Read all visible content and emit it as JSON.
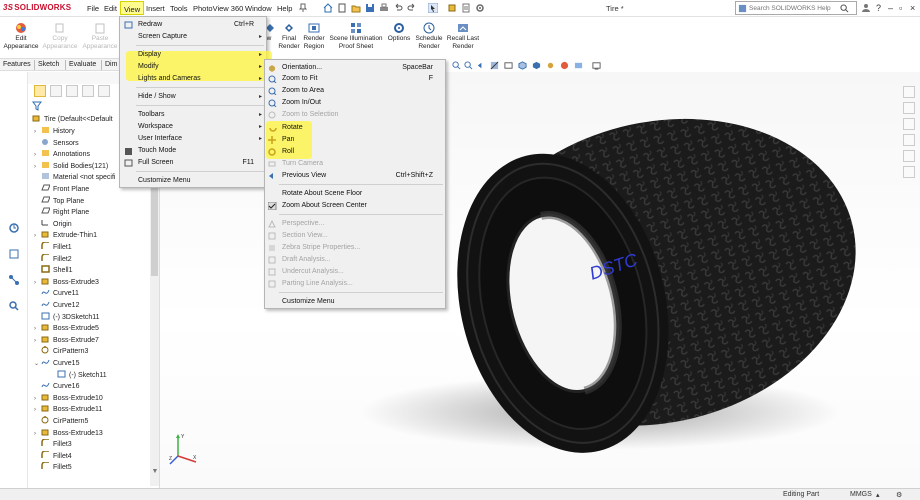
{
  "app": {
    "logo": "SOLIDWORKS",
    "document_title": "Tire *",
    "menus": [
      "File",
      "Edit",
      "View",
      "Insert",
      "Tools",
      "PhotoView 360",
      "Window",
      "Help"
    ],
    "active_menu": "View",
    "help_search_placeholder": "Search SOLIDWORKS Help"
  },
  "ribbon": {
    "buttons": [
      {
        "label": "Edit\nAppearance",
        "enabled": true,
        "icon": "appearance-icon"
      },
      {
        "label": "Copy\nAppearance",
        "enabled": false,
        "icon": "copy-appearance-icon"
      },
      {
        "label": "Paste\nAppearance",
        "enabled": false,
        "icon": "paste-appearance-icon"
      },
      {
        "label": "w",
        "enabled": true,
        "icon": "preview-icon"
      },
      {
        "label": "Final\nRender",
        "enabled": true,
        "icon": "final-render-icon"
      },
      {
        "label": "Render\nRegion",
        "enabled": true,
        "icon": "render-region-icon"
      },
      {
        "label": "Scene Illumination\nProof Sheet",
        "enabled": true,
        "icon": "proof-sheet-icon"
      },
      {
        "label": "Options",
        "enabled": true,
        "icon": "options-icon"
      },
      {
        "label": "Schedule\nRender",
        "enabled": true,
        "icon": "schedule-render-icon"
      },
      {
        "label": "Recall Last\nRender",
        "enabled": true,
        "icon": "recall-render-icon"
      }
    ]
  },
  "tabs": [
    "Features",
    "Sketch",
    "Evaluate",
    "Dim"
  ],
  "feature_tree": {
    "root": "Tire  (Default<<Default",
    "items": [
      {
        "label": "History",
        "icon": "history-icon",
        "expand": ">"
      },
      {
        "label": "Sensors",
        "icon": "sensors-icon",
        "expand": ""
      },
      {
        "label": "Annotations",
        "icon": "annotations-icon",
        "expand": ">"
      },
      {
        "label": "Solid Bodies(121)",
        "icon": "solid-bodies-icon",
        "expand": ">"
      },
      {
        "label": "Material <not specifi",
        "icon": "material-icon",
        "expand": ""
      },
      {
        "label": "Front Plane",
        "icon": "plane-icon",
        "expand": ""
      },
      {
        "label": "Top Plane",
        "icon": "plane-icon",
        "expand": ""
      },
      {
        "label": "Right Plane",
        "icon": "plane-icon",
        "expand": ""
      },
      {
        "label": "Origin",
        "icon": "origin-icon",
        "expand": ""
      },
      {
        "label": "Extrude-Thin1",
        "icon": "extrude-icon",
        "expand": ">"
      },
      {
        "label": "Fillet1",
        "icon": "fillet-icon",
        "expand": ""
      },
      {
        "label": "Fillet2",
        "icon": "fillet-icon",
        "expand": ""
      },
      {
        "label": "Shell1",
        "icon": "shell-icon",
        "expand": ""
      },
      {
        "label": "Boss-Extrude3",
        "icon": "extrude-icon",
        "expand": ">"
      },
      {
        "label": "Curve11",
        "icon": "curve-icon",
        "expand": ""
      },
      {
        "label": "Curve12",
        "icon": "curve-icon",
        "expand": ""
      },
      {
        "label": "(-) 3DSketch11",
        "icon": "sketch-icon",
        "expand": ""
      },
      {
        "label": "Boss-Extrude5",
        "icon": "extrude-icon",
        "expand": ">"
      },
      {
        "label": "Boss-Extrude7",
        "icon": "extrude-icon",
        "expand": ">"
      },
      {
        "label": "CirPattern3",
        "icon": "pattern-icon",
        "expand": ""
      },
      {
        "label": "Curve15",
        "icon": "curve-icon",
        "expand": "v"
      },
      {
        "label": "(-) Sketch11",
        "icon": "sketch-icon",
        "expand": "",
        "indent": true
      },
      {
        "label": "Curve16",
        "icon": "curve-icon",
        "expand": ""
      },
      {
        "label": "Boss-Extrude10",
        "icon": "extrude-icon",
        "expand": ">"
      },
      {
        "label": "Boss-Extrude11",
        "icon": "extrude-icon",
        "expand": ">"
      },
      {
        "label": "CirPattern5",
        "icon": "pattern-icon",
        "expand": ""
      },
      {
        "label": "Boss-Extrude13",
        "icon": "extrude-icon",
        "expand": ">"
      },
      {
        "label": "Fillet3",
        "icon": "fillet-icon",
        "expand": ""
      },
      {
        "label": "Fillet4",
        "icon": "fillet-icon",
        "expand": ""
      },
      {
        "label": "Fillet5",
        "icon": "fillet-icon",
        "expand": ""
      }
    ]
  },
  "view_menu": {
    "items": [
      {
        "label": "Redraw",
        "shortcut": "Ctrl+R",
        "icon": "redraw-icon",
        "submenu": false,
        "disabled": false
      },
      {
        "label": "Screen Capture",
        "shortcut": "",
        "icon": "",
        "submenu": true,
        "disabled": false
      },
      {
        "label": "Display",
        "shortcut": "",
        "icon": "",
        "submenu": true,
        "disabled": false
      },
      {
        "label": "Modify",
        "shortcut": "",
        "icon": "",
        "submenu": true,
        "disabled": false,
        "highlighted": true
      },
      {
        "label": "Lights and Cameras",
        "shortcut": "",
        "icon": "",
        "submenu": true,
        "disabled": false
      },
      {
        "label": "Hide / Show",
        "shortcut": "",
        "icon": "",
        "submenu": true,
        "disabled": false
      },
      {
        "label": "Toolbars",
        "shortcut": "",
        "icon": "",
        "submenu": true,
        "disabled": false
      },
      {
        "label": "Workspace",
        "shortcut": "",
        "icon": "",
        "submenu": true,
        "disabled": false
      },
      {
        "label": "User Interface",
        "shortcut": "",
        "icon": "",
        "submenu": true,
        "disabled": false
      },
      {
        "label": "Touch Mode",
        "shortcut": "",
        "icon": "touch-mode-icon",
        "submenu": false,
        "disabled": false
      },
      {
        "label": "Full Screen",
        "shortcut": "F11",
        "icon": "full-screen-icon",
        "submenu": false,
        "disabled": false
      },
      {
        "label": "Customize Menu",
        "shortcut": "",
        "icon": "",
        "submenu": false,
        "disabled": false
      }
    ]
  },
  "modify_menu": {
    "items": [
      {
        "label": "Orientation...",
        "shortcut": "SpaceBar",
        "icon": "orientation-icon",
        "disabled": false
      },
      {
        "label": "Zoom to Fit",
        "shortcut": "F",
        "icon": "zoom-fit-icon",
        "disabled": false
      },
      {
        "label": "Zoom to Area",
        "shortcut": "",
        "icon": "zoom-area-icon",
        "disabled": false
      },
      {
        "label": "Zoom In/Out",
        "shortcut": "",
        "icon": "zoom-in-out-icon",
        "disabled": false
      },
      {
        "label": "Zoom to Selection",
        "shortcut": "",
        "icon": "zoom-selection-icon",
        "disabled": true
      },
      {
        "label": "Rotate",
        "shortcut": "",
        "icon": "rotate-icon",
        "disabled": false,
        "marked": true
      },
      {
        "label": "Pan",
        "shortcut": "",
        "icon": "pan-icon",
        "disabled": false,
        "marked": true
      },
      {
        "label": "Roll",
        "shortcut": "",
        "icon": "roll-icon",
        "disabled": false,
        "marked": true
      },
      {
        "label": "Turn Camera",
        "shortcut": "",
        "icon": "turn-camera-icon",
        "disabled": true
      },
      {
        "label": "Previous View",
        "shortcut": "Ctrl+Shift+Z",
        "icon": "previous-view-icon",
        "disabled": false
      },
      {
        "label": "Rotate About Scene Floor",
        "shortcut": "",
        "icon": "",
        "disabled": false
      },
      {
        "label": "Zoom About Screen Center",
        "shortcut": "",
        "icon": "check-icon",
        "disabled": false
      },
      {
        "label": "Perspective...",
        "shortcut": "",
        "icon": "perspective-icon",
        "disabled": true
      },
      {
        "label": "Section View...",
        "shortcut": "",
        "icon": "section-view-icon",
        "disabled": true
      },
      {
        "label": "Zebra Stripe Properties...",
        "shortcut": "",
        "icon": "zebra-icon",
        "disabled": true
      },
      {
        "label": "Draft Analysis...",
        "shortcut": "",
        "icon": "draft-analysis-icon",
        "disabled": true
      },
      {
        "label": "Undercut Analysis...",
        "shortcut": "",
        "icon": "undercut-icon",
        "disabled": true
      },
      {
        "label": "Parting Line Analysis...",
        "shortcut": "",
        "icon": "parting-line-icon",
        "disabled": true
      },
      {
        "label": "Customize Menu",
        "shortcut": "",
        "icon": "",
        "disabled": false
      }
    ]
  },
  "status_bar": {
    "mode": "Editing Part",
    "units": "MMGS"
  },
  "colors": {
    "highlight_yellow": "#fffb8f",
    "brand_red": "#c8102e",
    "tire_dark": "#1a1a1a"
  }
}
